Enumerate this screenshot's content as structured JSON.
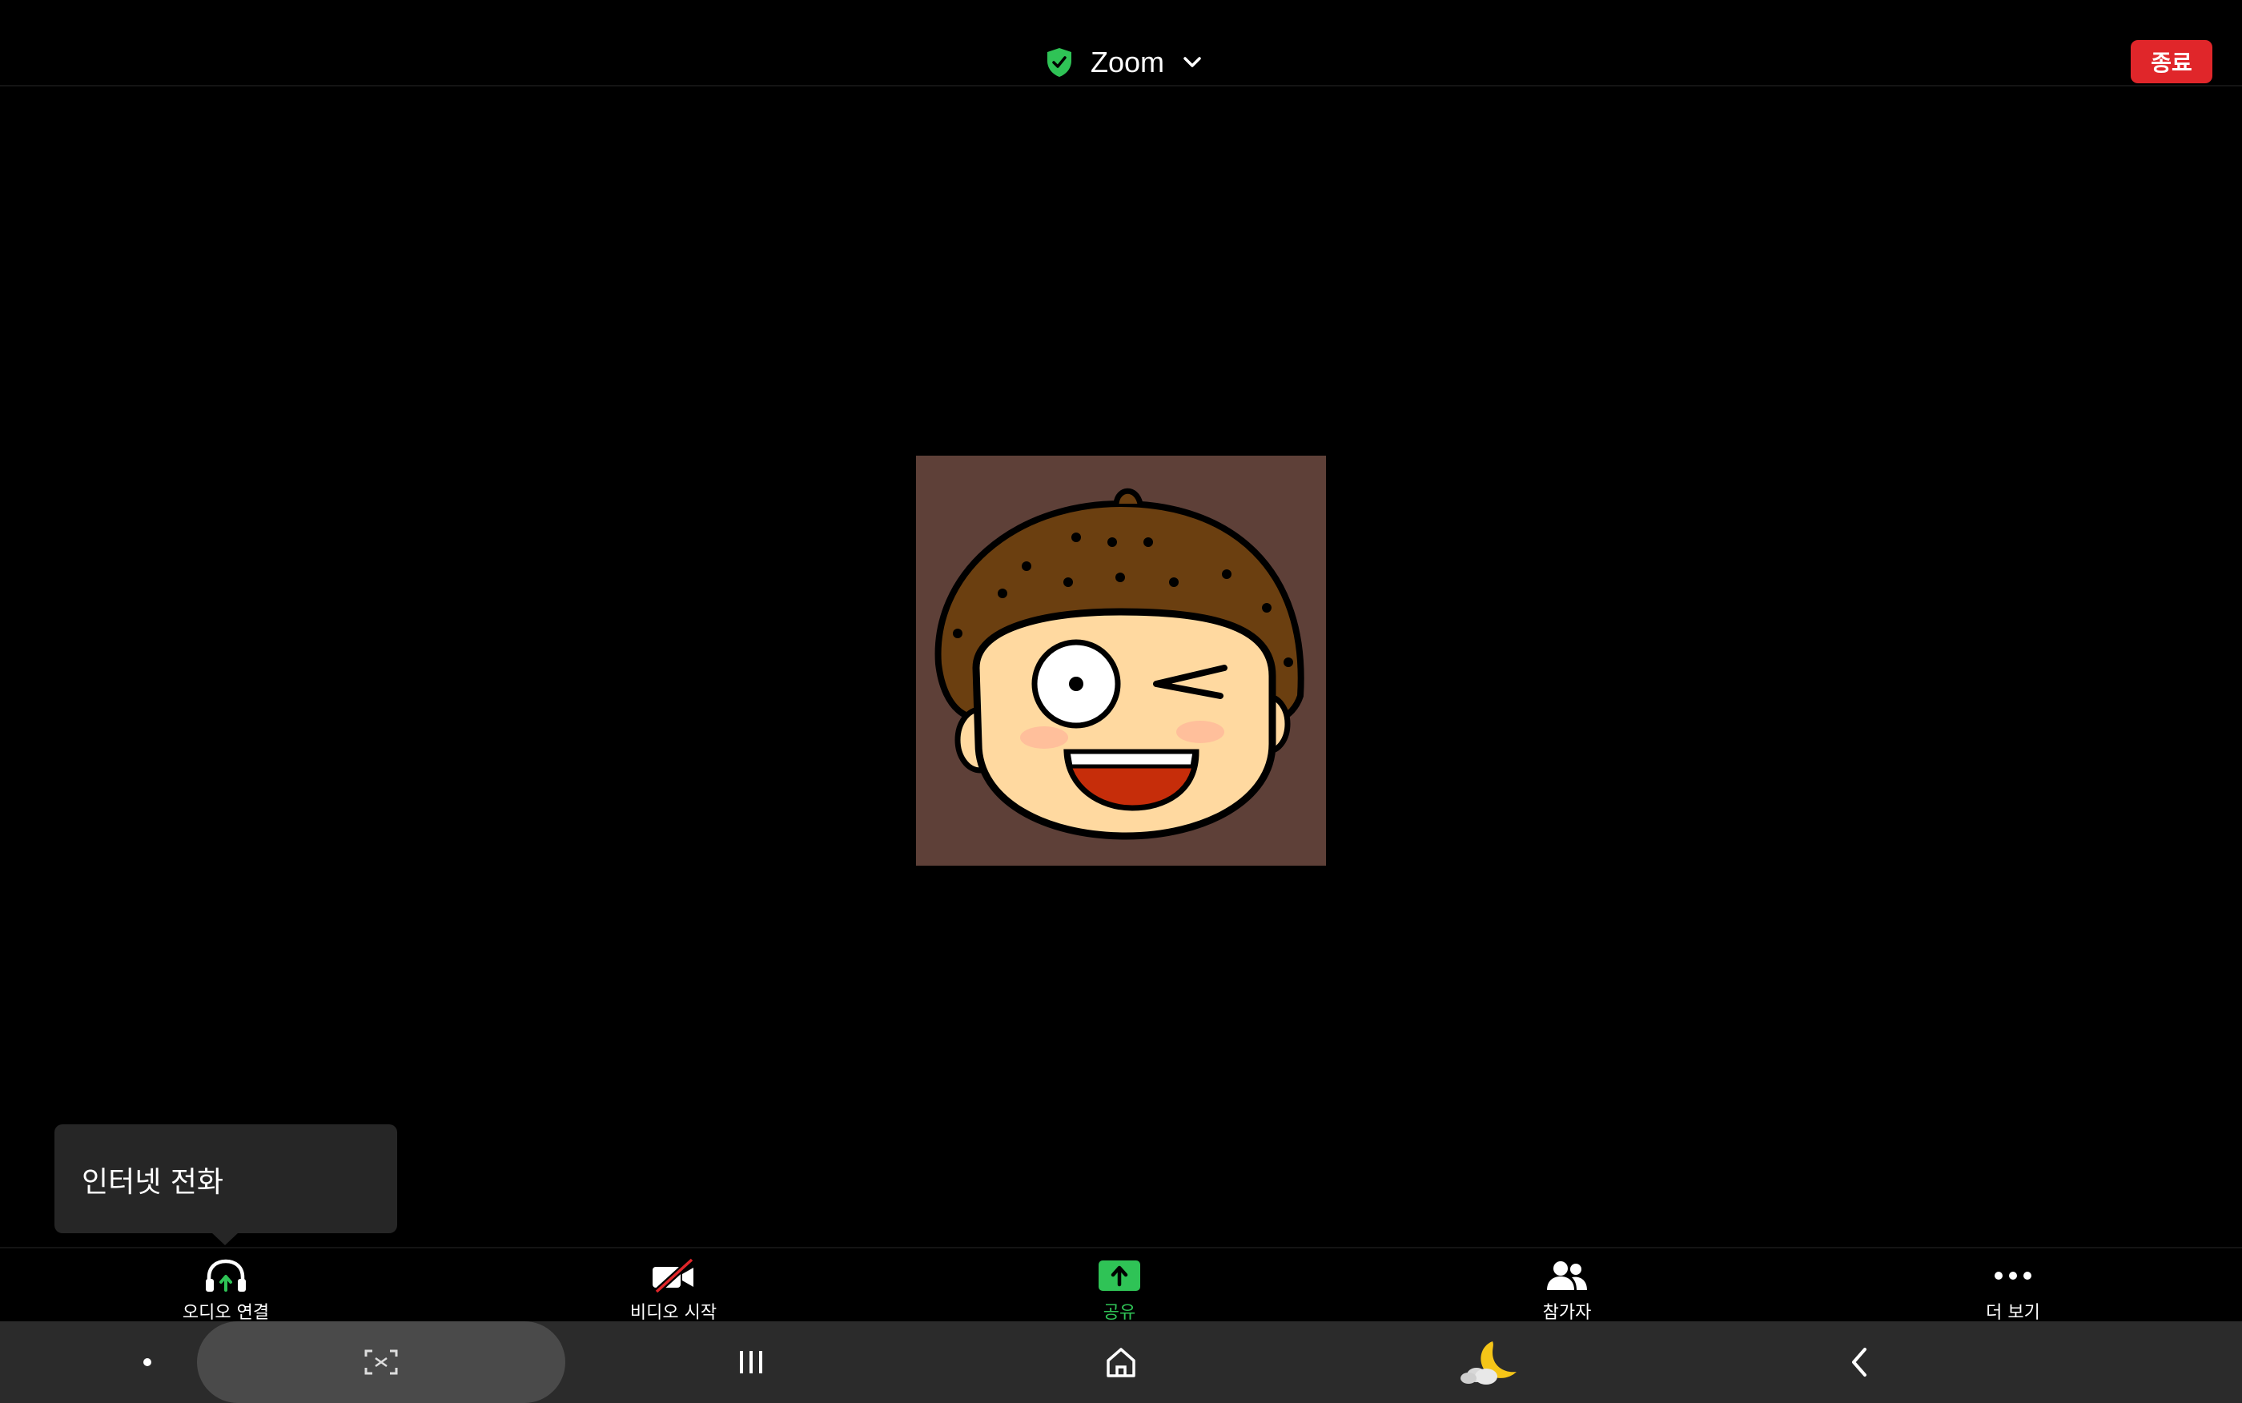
{
  "header": {
    "meeting_title": "Zoom",
    "end_button_label": "종료",
    "icons": {
      "security": "shield-check-icon",
      "dropdown": "chevron-down-icon"
    }
  },
  "colors": {
    "end_button": "#e0262a",
    "share_green": "#2fc356",
    "security_green": "#2fc356",
    "avatar_background": "#5e4038",
    "tooltip_background": "#262626",
    "navbar_background": "#2b2b2b"
  },
  "participant": {
    "avatar_icon": "winking-cartoon-face"
  },
  "tooltip": {
    "text": "인터넷 전화"
  },
  "toolbar": {
    "items": [
      {
        "label": "오디오 연결",
        "icon": "headphones-connect-icon"
      },
      {
        "label": "비디오 시작",
        "icon": "video-off-icon"
      },
      {
        "label": "공유",
        "icon": "share-screen-icon"
      },
      {
        "label": "참가자",
        "icon": "participants-icon"
      },
      {
        "label": "더 보기",
        "icon": "more-dots-icon"
      }
    ]
  },
  "navbar": {
    "items": [
      {
        "name": "dot-indicator",
        "icon": "dot-icon"
      },
      {
        "name": "screenshot",
        "icon": "screen-capture-icon"
      },
      {
        "name": "recents",
        "icon": "recent-apps-icon"
      },
      {
        "name": "home",
        "icon": "home-icon"
      },
      {
        "name": "night-mode",
        "icon": "moon-cloud-icon"
      },
      {
        "name": "back",
        "icon": "back-chevron-icon"
      }
    ]
  }
}
